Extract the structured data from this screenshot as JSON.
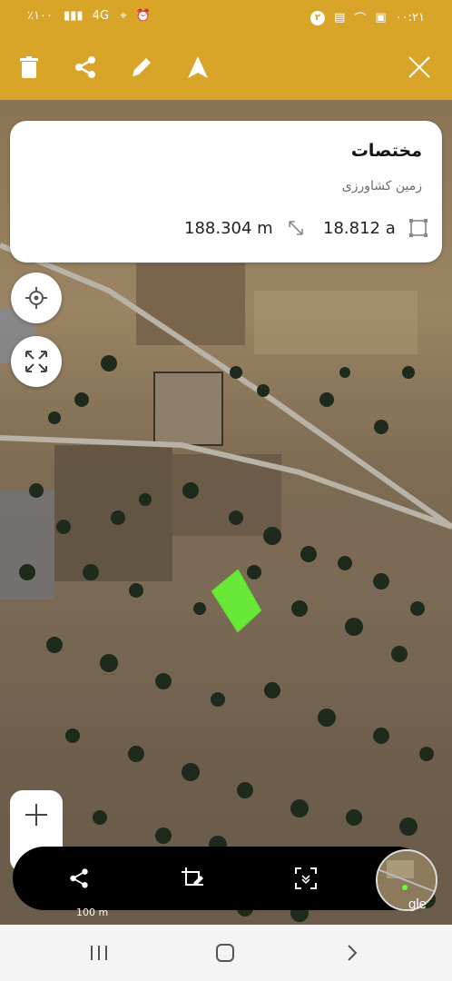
{
  "statusbar": {
    "battery": "٪۱۰۰",
    "network": "4G",
    "time": "۰۰:۲۱",
    "notification_count": "۲"
  },
  "toolbar": {
    "icons": [
      "trash-icon",
      "share-icon",
      "edit-pencil-icon",
      "navigate-arrow-icon",
      "close-icon"
    ]
  },
  "info_card": {
    "title": "مختصات",
    "subtitle": "زمین کشاورزی",
    "perimeter": "188.304 m",
    "area": "18.812 a"
  },
  "map": {
    "attribution": "gle",
    "scale": "100 m",
    "polygon_color": "#66ff33"
  },
  "bottombar": {
    "icons": [
      "share-icon",
      "crop-edit-icon",
      "scan-icon",
      "map-thumbnail"
    ]
  },
  "colors": {
    "accent": "#d9a528",
    "card_bg": "#ffffff",
    "bottombar_bg": "#000000"
  }
}
